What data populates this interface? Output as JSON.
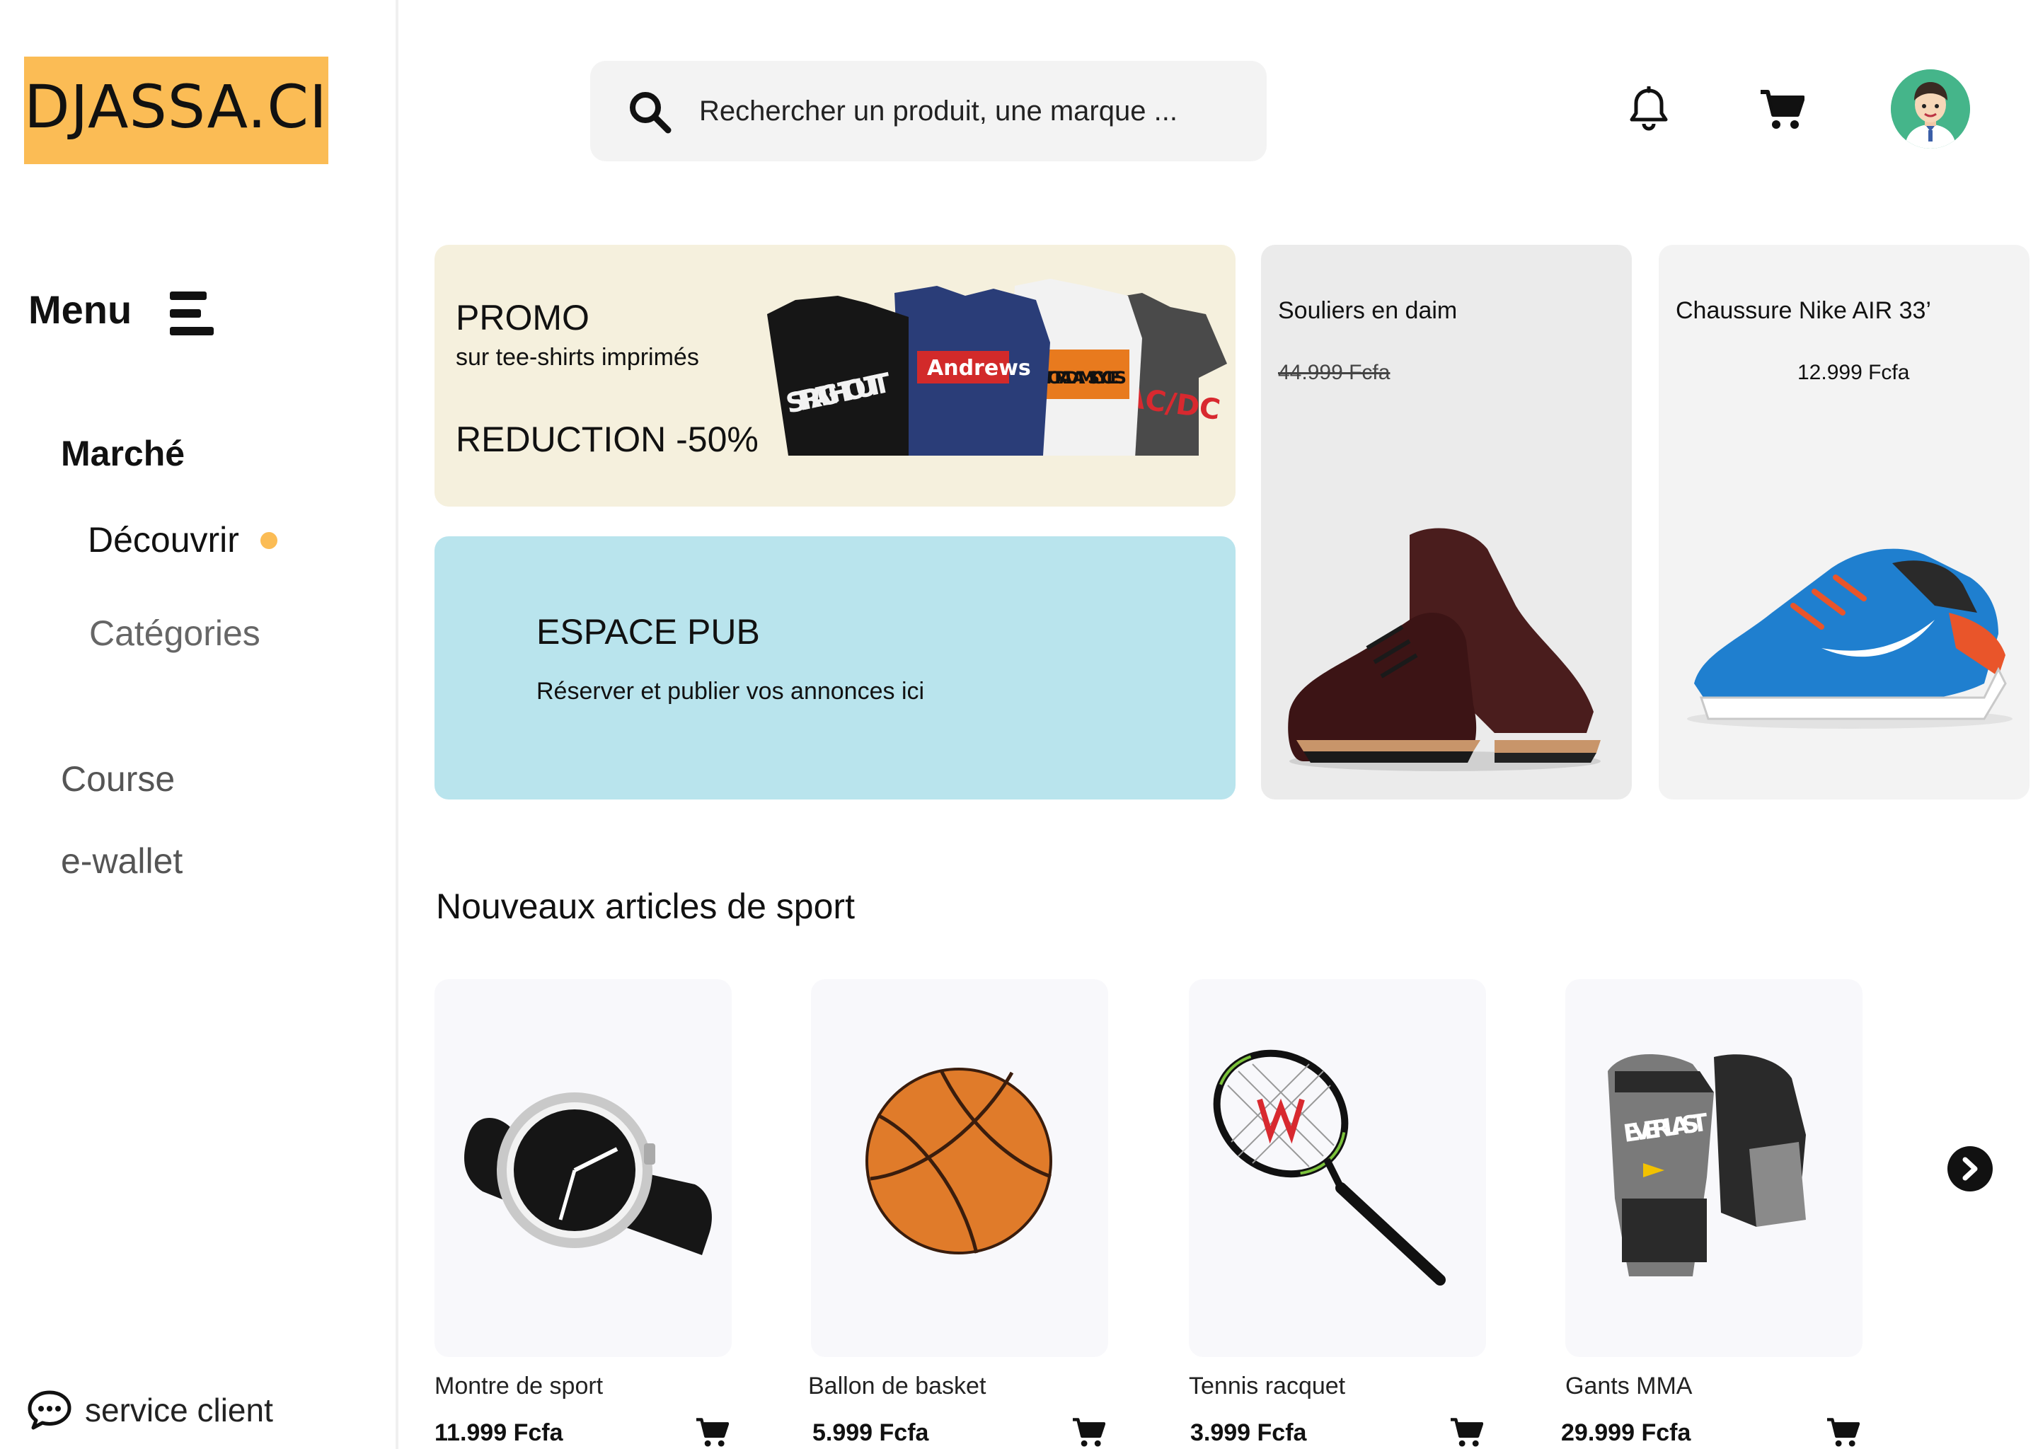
{
  "brand": {
    "logo_text": "DJASSA.CI",
    "accent": "#fbbc55"
  },
  "sidebar": {
    "menu_label": "Menu",
    "items": [
      {
        "label": "Marché"
      },
      {
        "label": "Découvrir"
      },
      {
        "label": "Catégories"
      },
      {
        "label": "Course"
      },
      {
        "label": "e-wallet"
      }
    ],
    "support_label": "service client"
  },
  "header": {
    "search_placeholder": "Rechercher un produit, une marque ...",
    "icons": [
      "search-icon",
      "bell-icon",
      "cart-icon",
      "avatar"
    ]
  },
  "promo": {
    "title": "PROMO",
    "subtitle": "sur tee-shirts imprimés",
    "reduction": "REDUCTION -50%",
    "tee_texts": [
      "STRAIGHT OUTT",
      "Andrews",
      "MOTOR ADAMS CYCLES",
      "AC/DC"
    ]
  },
  "pub": {
    "title": "ESPACE PUB",
    "subtitle": "Réserver et publier vos annonces ici",
    "background": "#b9e4ed"
  },
  "featured": [
    {
      "name": "Souliers en daim",
      "price": "44.999 Fcfa",
      "strikethrough": true
    },
    {
      "name": "Chaussure Nike AIR 33’",
      "price": "12.999 Fcfa",
      "strikethrough": false
    }
  ],
  "section": {
    "title": "Nouveaux articles de sport"
  },
  "products": [
    {
      "name": "Montre de sport",
      "price": "11.999 Fcfa"
    },
    {
      "name": "Ballon de basket",
      "price": "5.999 Fcfa"
    },
    {
      "name": "Tennis racquet",
      "price": "3.999 Fcfa"
    },
    {
      "name": "Gants MMA",
      "price": "29.999 Fcfa",
      "brand_print": "EVERLAST"
    }
  ]
}
